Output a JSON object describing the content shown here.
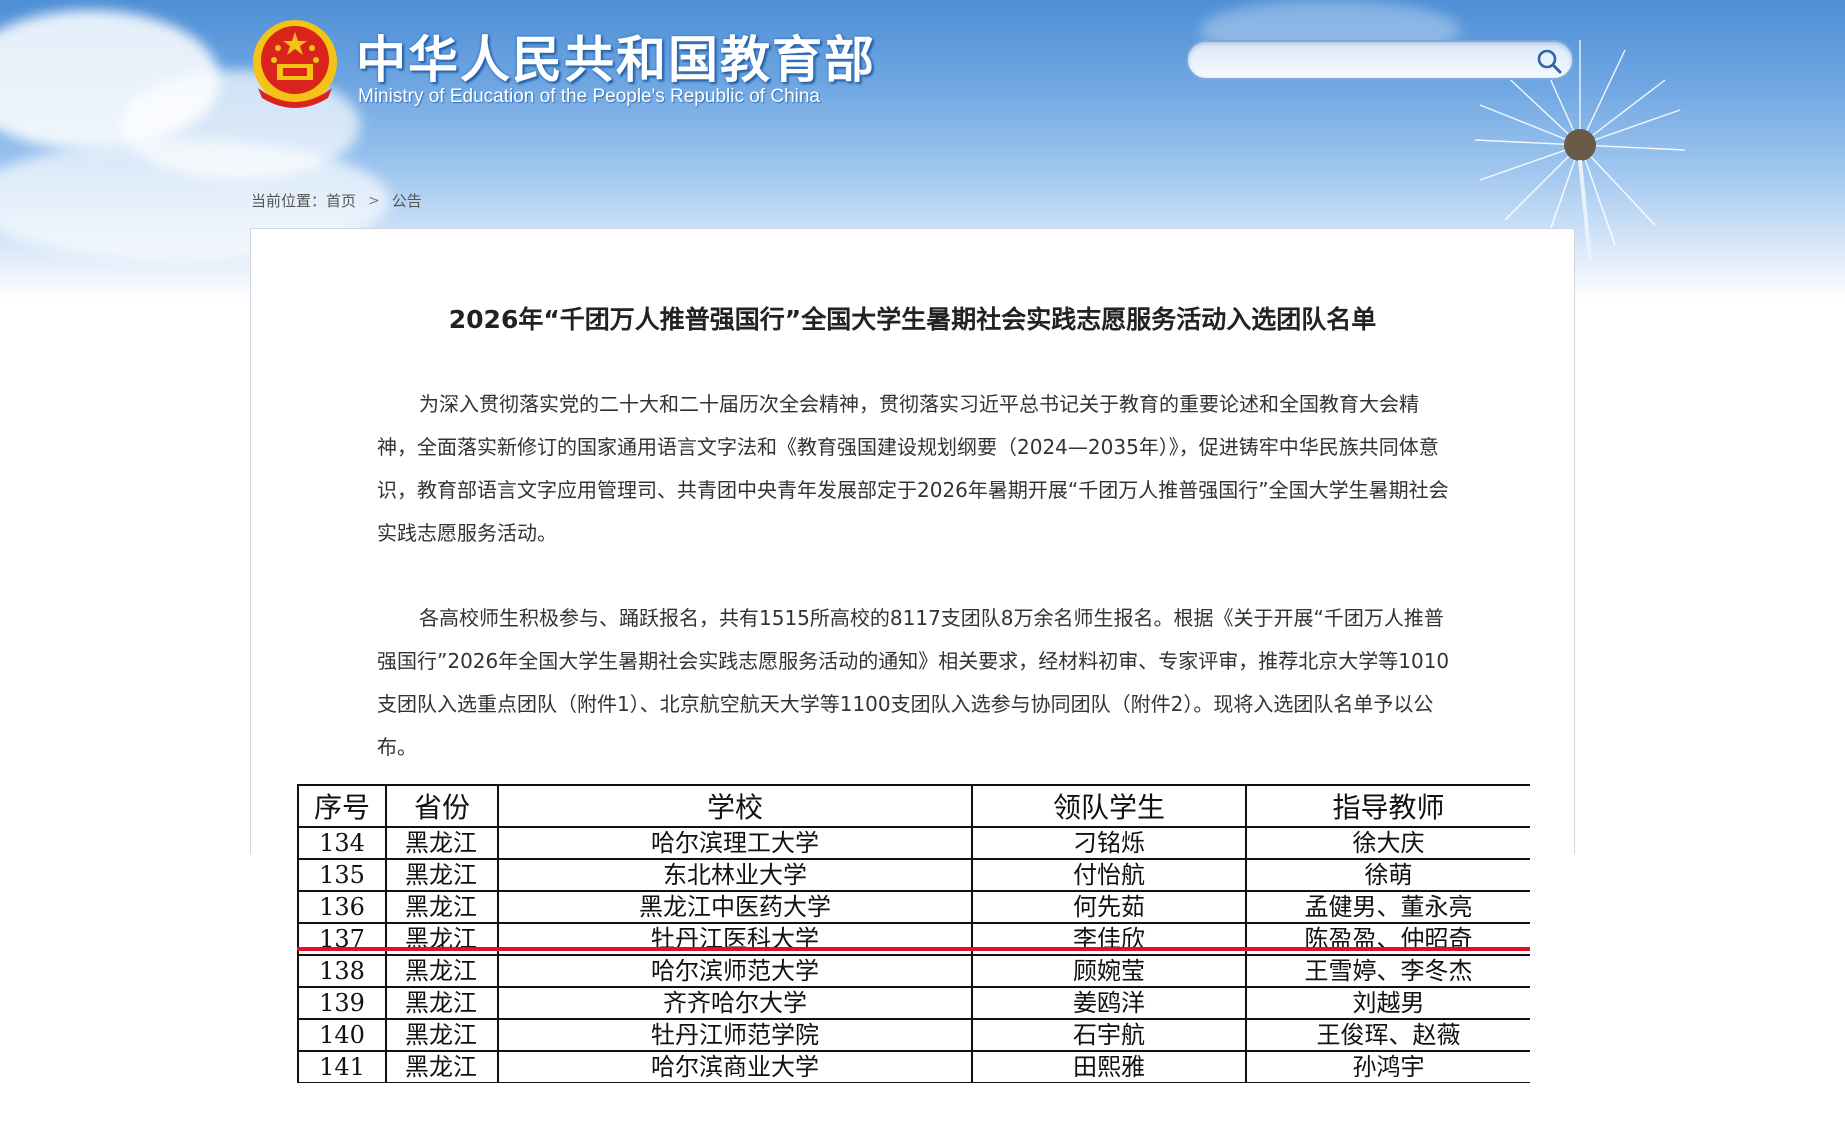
{
  "header": {
    "site_title_cn": "中华人民共和国教育部",
    "site_title_en": "Ministry of Education of the People's Republic of China",
    "search": {
      "value": "",
      "placeholder": ""
    }
  },
  "breadcrumb": {
    "label": "当前位置：",
    "items": [
      "首页",
      "公告"
    ]
  },
  "article": {
    "title": "2026年“千团万人推普强国行”全国大学生暑期社会实践志愿服务活动入选团队名单",
    "paragraphs": [
      "为深入贯彻落实党的二十大和二十届历次全会精神，贯彻落实习近平总书记关于教育的重要论述和全国教育大会精神，全面落实新修订的国家通用语言文字法和《教育强国建设规划纲要（2024—2035年）》，促进铸牢中华民族共同体意识，教育部语言文字应用管理司、共青团中央青年发展部定于2026年暑期开展“千团万人推普强国行”全国大学生暑期社会实践志愿服务活动。",
      "各高校师生积极参与、踊跃报名，共有1515所高校的8117支团队8万余名师生报名。根据《关于开展“千团万人推普强国行”2026年全国大学生暑期社会实践志愿服务活动的通知》相关要求，经材料初审、专家评审，推荐北京大学等1010支团队入选重点团队（附件1）、北京航空航天大学等1100支团队入选参与协同团队（附件2）。现将入选团队名单予以公布。"
    ]
  },
  "table": {
    "headers": [
      "序号",
      "省份",
      "学校",
      "领队学生",
      "指导教师"
    ],
    "rows": [
      [
        "134",
        "黑龙江",
        "哈尔滨理工大学",
        "刁铭烁",
        "徐大庆"
      ],
      [
        "135",
        "黑龙江",
        "东北林业大学",
        "付怡航",
        "徐萌"
      ],
      [
        "136",
        "黑龙江",
        "黑龙江中医药大学",
        "何先茹",
        "孟健男、董永亮"
      ],
      [
        "137",
        "黑龙江",
        "牡丹江医科大学",
        "李佳欣",
        "陈盈盈、仲昭奇"
      ],
      [
        "138",
        "黑龙江",
        "哈尔滨师范大学",
        "顾婉莹",
        "王雪婷、李冬杰"
      ],
      [
        "139",
        "黑龙江",
        "齐齐哈尔大学",
        "姜鸥洋",
        "刘越男"
      ],
      [
        "140",
        "黑龙江",
        "牡丹江师范学院",
        "石宇航",
        "王俊珲、赵薇"
      ],
      [
        "141",
        "黑龙江",
        "哈尔滨商业大学",
        "田熙雅",
        "孙鸿宇"
      ]
    ],
    "highlight_color": "#e0102a"
  },
  "colors": {
    "header_blue": "#4f8fd6",
    "emblem_red": "#d9231b",
    "emblem_gold": "#f3c316"
  },
  "icons": [
    "national-emblem-icon",
    "search-icon",
    "chevron-right-icon",
    "dandelion-icon"
  ]
}
